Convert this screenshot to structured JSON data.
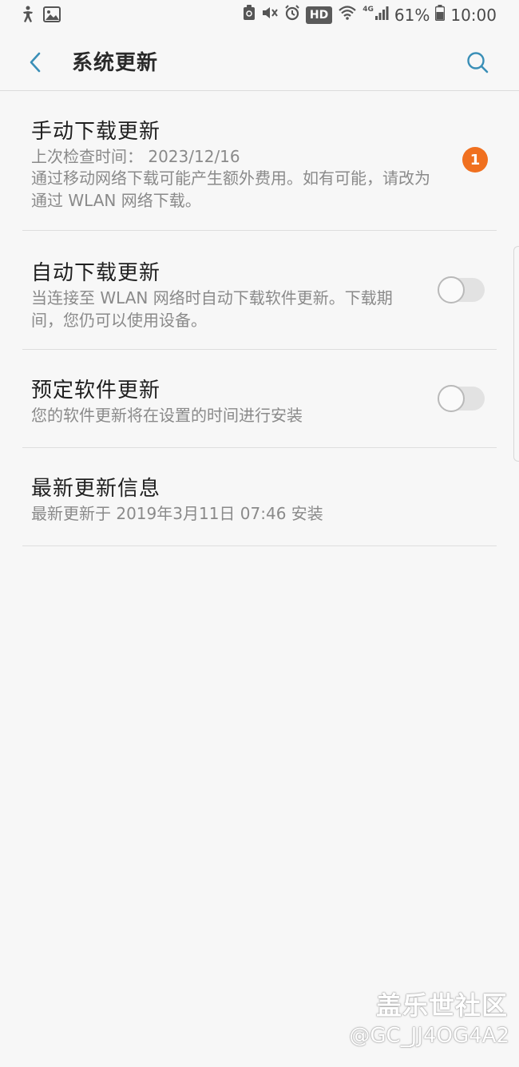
{
  "status_bar": {
    "network_type": "4G",
    "hd_badge": "HD",
    "battery": "61%",
    "time": "10:00",
    "icons": [
      "accessibility-icon",
      "image-icon",
      "recycle-icon",
      "mute-icon",
      "alarm-icon",
      "wifi-icon",
      "signal-icon",
      "battery-icon"
    ]
  },
  "app_bar": {
    "title": "系统更新",
    "accent_color": "#3a8fb7"
  },
  "settings": {
    "manual_download": {
      "title": "手动下载更新",
      "last_check": "上次检查时间： 2023/12/16",
      "description": "通过移动网络下载可能产生额外费用。如有可能，请改为通过 WLAN 网络下载。",
      "badge": "1",
      "badge_color": "#f0701f"
    },
    "auto_download": {
      "title": "自动下载更新",
      "description": "当连接至 WLAN 网络时自动下载软件更新。下载期间，您仍可以使用设备。",
      "enabled": false
    },
    "scheduled_update": {
      "title": "预定软件更新",
      "description": "您的软件更新将在设置的时间进行安装",
      "enabled": false
    },
    "latest_update_info": {
      "title": "最新更新信息",
      "description": "最新更新于 2019年3月11日 07:46 安装"
    }
  },
  "watermark": {
    "brand": "盖乐世社区",
    "user": "@GC_JJ4OG4A2"
  }
}
